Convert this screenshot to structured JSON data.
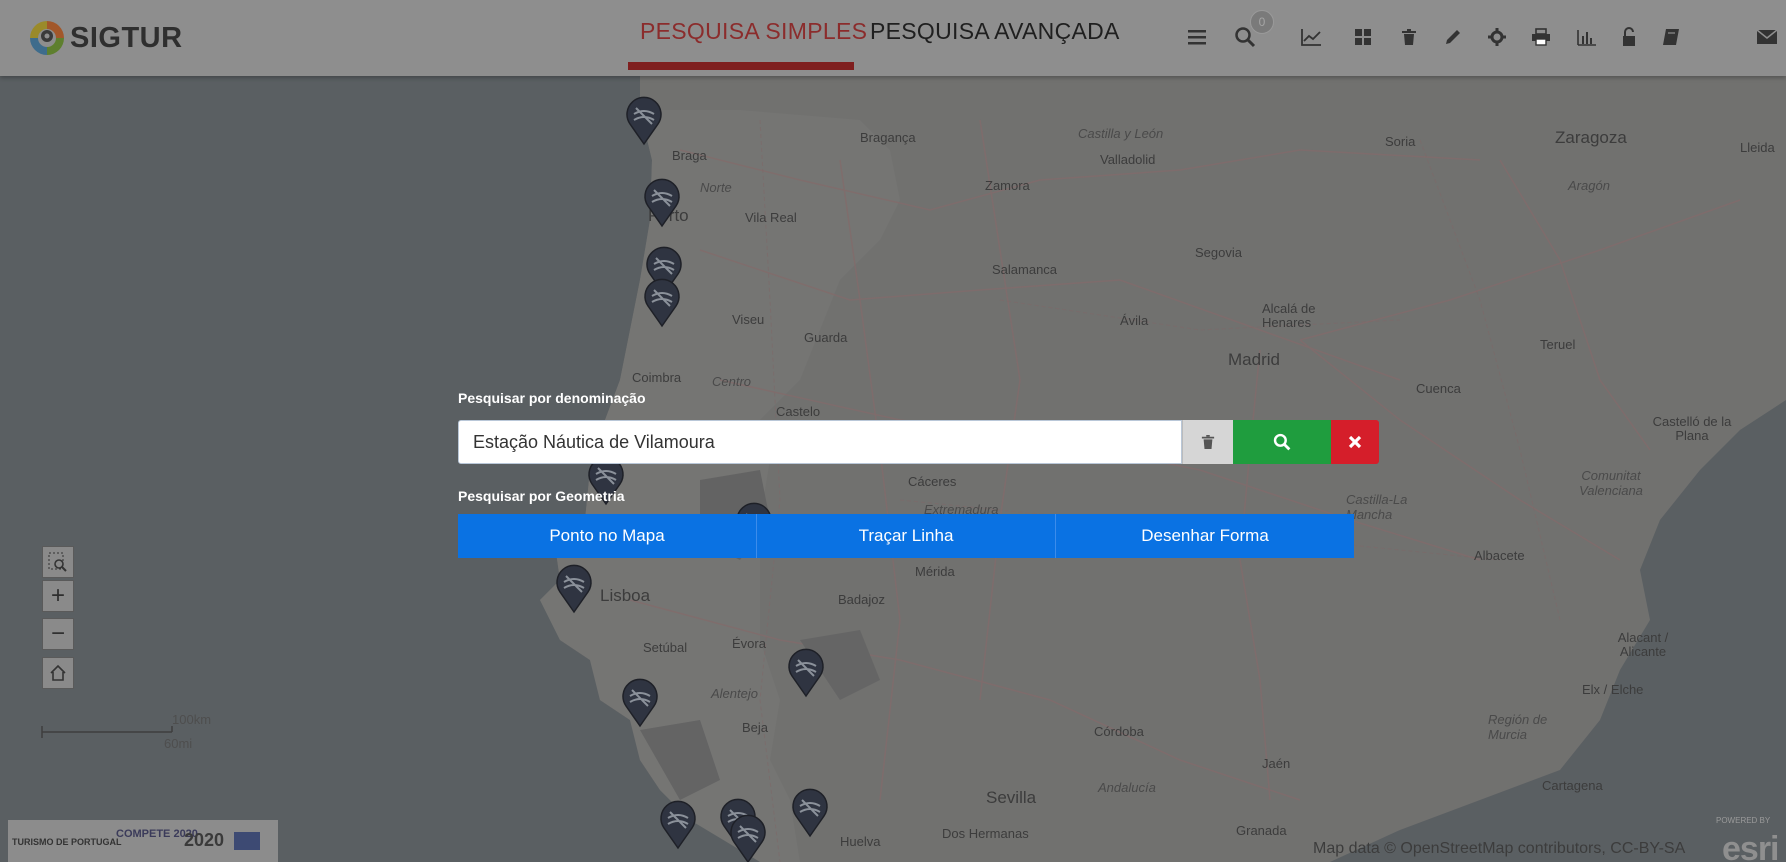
{
  "app": {
    "name": "SIGTUR"
  },
  "tabs": [
    {
      "label": "PESQUISA SIMPLES",
      "active": true
    },
    {
      "label": "PESQUISA AVANÇADA",
      "active": false
    }
  ],
  "toolbar": {
    "icons": [
      "menu-icon",
      "search-icon",
      "chart-line-icon",
      "grid-icon",
      "trash-icon",
      "pencil-icon",
      "gear-icon",
      "print-icon",
      "bar-chart-icon",
      "unlock-icon",
      "book-icon",
      "mail-icon"
    ],
    "badge_count": "0"
  },
  "search": {
    "name_label": "Pesquisar por denominação",
    "query": "Estação Náutica de Vilamoura",
    "geometry_label": "Pesquisar por Geometria",
    "geometry_buttons": [
      "Ponto no Mapa",
      "Traçar Linha",
      "Desenhar Forma"
    ]
  },
  "map": {
    "labels": {
      "castilla": "Castilla y León",
      "valladolid": "Valladolid",
      "braganca": "Bragança",
      "braga": "Braga",
      "norte": "Norte",
      "vilareal": "Vila Real",
      "zamora": "Zamora",
      "porto": "Porto",
      "soria": "Soria",
      "zaragoza": "Zaragoza",
      "aragon": "Aragón",
      "lleida": "Lleida",
      "segovia": "Segovia",
      "salamanca": "Salamanca",
      "viseu": "Viseu",
      "guarda": "Guarda",
      "avila": "Ávila",
      "alcala": "Alcalá de Henares",
      "madrid": "Madrid",
      "teruel": "Teruel",
      "coimbra": "Coimbra",
      "centro": "Centro",
      "castelo": "Castelo",
      "cuenca": "Cuenca",
      "castello": "Castelló de la Plana",
      "caceres": "Cáceres",
      "extremadura": "Extremadura",
      "castillalam": "Castilla-La Mancha",
      "comunitat": "Comunitat Valenciana",
      "merida": "Mérida",
      "albacete": "Albacete",
      "lisboa": "Lisboa",
      "badajoz": "Badajoz",
      "setubal": "Setúbal",
      "evora": "Évora",
      "alicante": "Alacant / Alicante",
      "alentejo": "Alentejo",
      "elx": "Elx / Elche",
      "beja": "Beja",
      "cordoba": "Córdoba",
      "region": "Región de Murcia",
      "jaen": "Jaén",
      "andalucia": "Andalucía",
      "cartagena": "Cartagena",
      "sevilla": "Sevilla",
      "huelva": "Huelva",
      "doshermanas": "Dos Hermanas",
      "granada": "Granada"
    },
    "scale": {
      "km": "100km",
      "mi": "60mi"
    },
    "attribution": "Map data © OpenStreetMap contributors, CC-BY-SA",
    "esri": "esri",
    "powered": "POWERED BY"
  },
  "footer": {
    "partner_logos": [
      "TURISMO DE PORTUGAL",
      "COMPETE 2020",
      "2020"
    ]
  },
  "colors": {
    "topbar": "#8e8e8e",
    "active_tab": "#8b2c2c",
    "search_green": "#1f9d3e",
    "close_red": "#d51e2a",
    "geometry_blue": "#0a72e3"
  }
}
